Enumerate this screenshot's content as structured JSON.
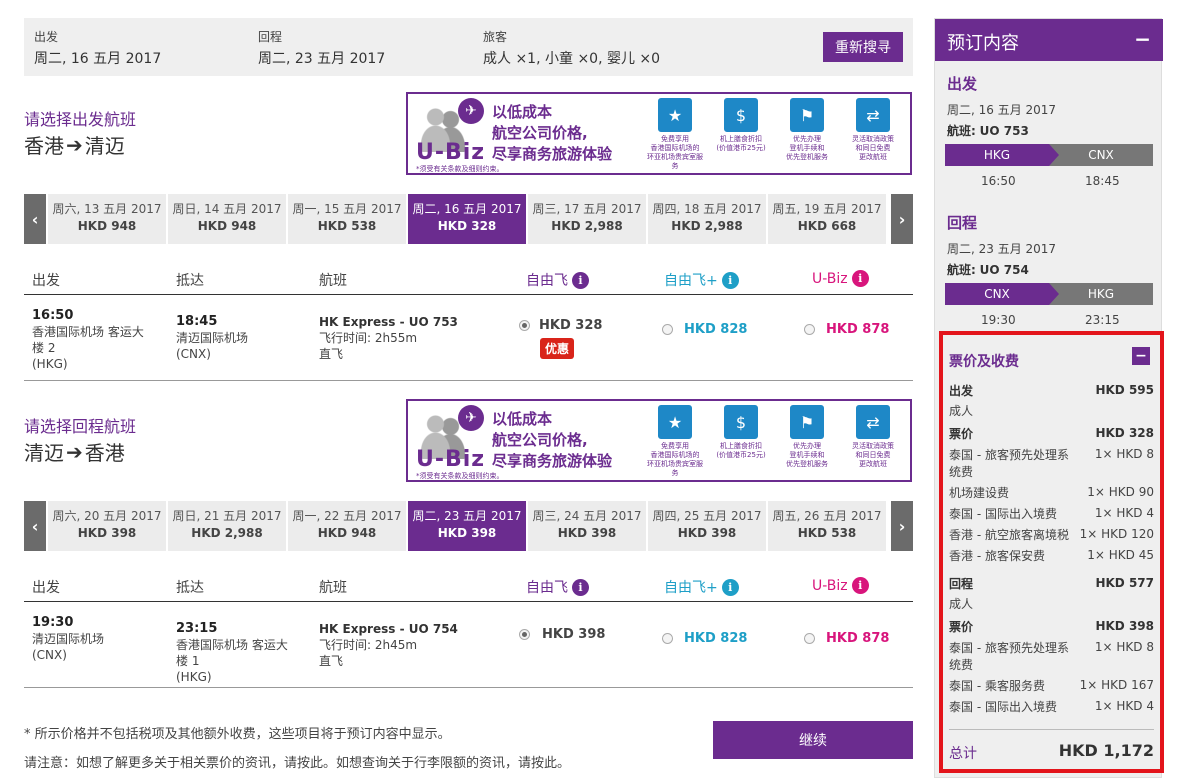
{
  "search": {
    "depart_label": "出发",
    "depart_value": "周二, 16 五月 2017",
    "return_label": "回程",
    "return_value": "周二, 23 五月 2017",
    "pax_label": "旅客",
    "pax_value": "成人 ×1, 小童 ×0, 婴儿 ×0",
    "research_button": "重新搜寻"
  },
  "banner": {
    "brand": "U-Biz",
    "slogan_1": "以低成本",
    "slogan_2": "航空公司价格,",
    "slogan_3": "尽享商务旅游体验",
    "note": "*须受有关条款及细则约束。",
    "features": [
      {
        "icon": "lounge-icon",
        "l1": "免费享用",
        "l2": "香港国际机场的",
        "l3": "环亚机场贵宾室服务"
      },
      {
        "icon": "voucher-icon",
        "l1": "机上膳食折扣",
        "l2": "(价值港币25元)",
        "l3": ""
      },
      {
        "icon": "priority-icon",
        "l1": "优先办理",
        "l2": "登机手续和",
        "l3": "优先登机服务"
      },
      {
        "icon": "change-icon",
        "l1": "灵活取消政策",
        "l2": "和同日免费",
        "l3": "更改航班"
      }
    ]
  },
  "outbound": {
    "title": "请选择出发航班",
    "from": "香港",
    "to": "清迈",
    "dates": [
      {
        "d": "周六, 13 五月 2017",
        "p": "HKD 948"
      },
      {
        "d": "周日, 14 五月 2017",
        "p": "HKD 948"
      },
      {
        "d": "周一, 15 五月 2017",
        "p": "HKD 538"
      },
      {
        "d": "周二, 16 五月 2017",
        "p": "HKD 328"
      },
      {
        "d": "周三, 17 五月 2017",
        "p": "HKD 2,988"
      },
      {
        "d": "周四, 18 五月 2017",
        "p": "HKD 2,988"
      },
      {
        "d": "周五, 19 五月 2017",
        "p": "HKD 668"
      }
    ],
    "selected_index": 3,
    "flight": {
      "dep_time": "16:50",
      "dep_airport_1": "香港国际机场 客运大",
      "dep_airport_2": "楼 2",
      "dep_code": "(HKG)",
      "arr_time": "18:45",
      "arr_airport_1": "清迈国际机场",
      "arr_airport_2": "",
      "arr_code": "(CNX)",
      "flight_no": "HK Express - UO 753",
      "duration": "飞行时间: 2h55m",
      "stops": "直飞",
      "fare1": "HKD 328",
      "fare2": "HKD 828",
      "fare3": "HKD 878",
      "promo": "优惠"
    }
  },
  "inbound": {
    "title": "请选择回程航班",
    "from": "清迈",
    "to": "香港",
    "dates": [
      {
        "d": "周六, 20 五月 2017",
        "p": "HKD 398"
      },
      {
        "d": "周日, 21 五月 2017",
        "p": "HKD 2,988"
      },
      {
        "d": "周一, 22 五月 2017",
        "p": "HKD 948"
      },
      {
        "d": "周二, 23 五月 2017",
        "p": "HKD 398"
      },
      {
        "d": "周三, 24 五月 2017",
        "p": "HKD 398"
      },
      {
        "d": "周四, 25 五月 2017",
        "p": "HKD 398"
      },
      {
        "d": "周五, 26 五月 2017",
        "p": "HKD 538"
      }
    ],
    "selected_index": 3,
    "flight": {
      "dep_time": "19:30",
      "dep_airport_1": "清迈国际机场",
      "dep_airport_2": "",
      "dep_code": "(CNX)",
      "arr_time": "23:15",
      "arr_airport_1": "香港国际机场 客运大",
      "arr_airport_2": "楼 1",
      "arr_code": "(HKG)",
      "flight_no": "HK Express - UO 754",
      "duration": "飞行时间: 2h45m",
      "stops": "直飞",
      "fare1": "HKD 398",
      "fare2": "HKD 828",
      "fare3": "HKD 878"
    }
  },
  "table_headers": {
    "depart": "出发",
    "arrive": "抵达",
    "flight": "航班",
    "fare1": "自由飞",
    "fare2": "自由飞+",
    "fare3": "U-Biz"
  },
  "fare_colors": {
    "fare1": "#6b2c8f",
    "fare2": "#1e9fc7",
    "fare3": "#d8157c"
  },
  "notes": {
    "tax": "* 所示价格并不包括税项及其他额外收费，这些项目将于预订内容中显示。",
    "info": "请注意：如想了解更多关于相关票价的资讯，请按此。如想查询关于行李限额的资讯，请按此。",
    "continue_button": "继续"
  },
  "summary": {
    "title": "预订内容",
    "minus": "−",
    "out_label": "出发",
    "out_date": "周二, 16 五月 2017",
    "out_flight_label": "航班:",
    "out_flight": "UO 753",
    "out_from": "HKG",
    "out_to": "CNX",
    "out_dep": "16:50",
    "out_arr": "18:45",
    "ret_label": "回程",
    "ret_date": "周二, 23 五月 2017",
    "ret_flight_label": "航班:",
    "ret_flight": "UO 754",
    "ret_from": "CNX",
    "ret_to": "HKG",
    "ret_dep": "19:30",
    "ret_arr": "23:15"
  },
  "fees": {
    "title": "票价及收费",
    "out_label": "出发",
    "out_total": "HKD 595",
    "out_pax": "成人",
    "out_fare_label": "票价",
    "out_fare": "HKD 328",
    "out_items": [
      {
        "l": "泰国 - 旅客预先处理系统费",
        "r": "1× HKD 8"
      },
      {
        "l": "机场建设费",
        "r": "1× HKD 90"
      },
      {
        "l": "泰国 - 国际出入境费",
        "r": "1× HKD 4"
      },
      {
        "l": "香港 - 航空旅客离境税",
        "r": "1× HKD 120"
      },
      {
        "l": "香港 - 旅客保安费",
        "r": "1× HKD 45"
      }
    ],
    "ret_label": "回程",
    "ret_total": "HKD 577",
    "ret_pax": "成人",
    "ret_fare_label": "票价",
    "ret_fare": "HKD 398",
    "ret_items": [
      {
        "l": "泰国 - 旅客预先处理系统费",
        "r": "1× HKD 8"
      },
      {
        "l": "泰国 - 乘客服务费",
        "r": "1× HKD 167"
      },
      {
        "l": "泰国 - 国际出入境费",
        "r": "1× HKD 4"
      }
    ],
    "total_label": "总计",
    "total_value": "HKD 1,172"
  }
}
